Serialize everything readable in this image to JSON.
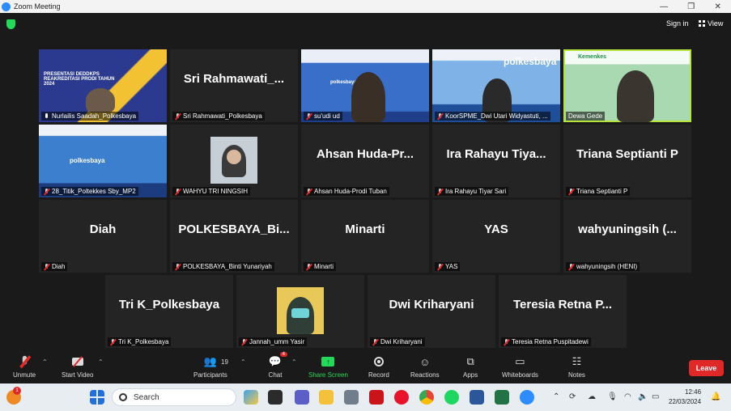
{
  "window": {
    "title": "Zoom Meeting",
    "controls": [
      "—",
      "❐",
      "✕"
    ]
  },
  "topbar": {
    "signin": "Sign in",
    "view": "View"
  },
  "tiles": [
    {
      "label": "Nurlailis Saadah_Polkesbaya",
      "big": "",
      "muted": false,
      "slide_title": "PRESENTASI DEDDKPS REAKREDITASI PRODI TAHUN 2024"
    },
    {
      "label": "Sri Rahmawati_Polkesbaya",
      "big": "Sri  Rahmawati_...",
      "muted": true
    },
    {
      "label": "su'udi ud",
      "big": "",
      "muted": true,
      "brand": "polkesbaya"
    },
    {
      "label": "KoorSPME_Dwi Utari Widyastuti, ...",
      "big": "",
      "muted": true,
      "brand": "polkesbaya"
    },
    {
      "label": "Dewa Gede",
      "big": "",
      "muted": false,
      "active": true,
      "brand": "Kemenkes"
    },
    {
      "label": "28_Titik_Poltekkes Sby_MP2",
      "big": "",
      "muted": true,
      "brand": "polkesbaya"
    },
    {
      "label": "WAHYU TRI NINGSIH",
      "big": "",
      "muted": true
    },
    {
      "label": "Ahsan Huda-Prodi Tuban",
      "big": "Ahsan  Huda-Pr...",
      "muted": true
    },
    {
      "label": "Ira Rahayu Tiyar Sari",
      "big": "Ira  Rahayu  Tiya...",
      "muted": true
    },
    {
      "label": "Triana Septianti P",
      "big": "Triana  Septianti  P",
      "muted": true
    },
    {
      "label": "Diah",
      "big": "Diah",
      "muted": true
    },
    {
      "label": "POLKESBAYA_Binti Yunariyah",
      "big": "POLKESBAYA_Bi...",
      "muted": true
    },
    {
      "label": "Minarti",
      "big": "Minarti",
      "muted": true
    },
    {
      "label": "YAS",
      "big": "YAS",
      "muted": true
    },
    {
      "label": "wahyuningsih (HENI)",
      "big": "wahyuningsih  (...",
      "muted": true
    },
    {
      "label": "Tri K_Polkesbaya",
      "big": "Tri  K_Polkesbaya",
      "muted": true
    },
    {
      "label": "Jannah_umm Yasir",
      "big": "",
      "muted": true
    },
    {
      "label": "Dwi Kriharyani",
      "big": "Dwi  Kriharyani",
      "muted": true
    },
    {
      "label": "Teresia Retna Puspitadewi",
      "big": "Teresia  Retna  P...",
      "muted": true
    }
  ],
  "toolbar": {
    "unmute": "Unmute",
    "start_video": "Start Video",
    "participants": "Participants",
    "participants_count": "19",
    "chat": "Chat",
    "chat_badge": "4",
    "share": "Share Screen",
    "record": "Record",
    "reactions": "Reactions",
    "apps": "Apps",
    "whiteboards": "Whiteboards",
    "notes": "Notes",
    "leave": "Leave"
  },
  "taskbar": {
    "search_placeholder": "Search",
    "notification_count": "1",
    "time": "12:46",
    "date": "22/03/2024"
  },
  "colors": {
    "share_green": "#23d959",
    "leave_red": "#e02828",
    "active_speaker": "#b5e53a"
  }
}
